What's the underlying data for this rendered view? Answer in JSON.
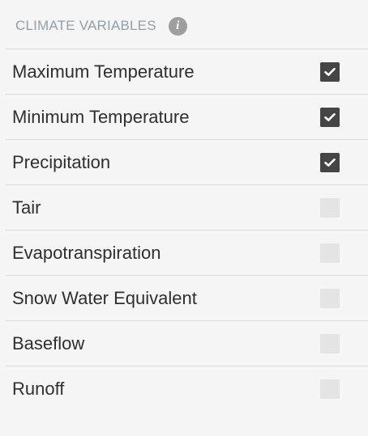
{
  "section": {
    "title": "CLIMATE VARIABLES",
    "info_glyph": "i"
  },
  "colors": {
    "background": "#f5f5f5",
    "header_text": "#8fa1ad",
    "info_icon": "#9e9e9e",
    "checkbox_checked": "#454545",
    "checkbox_unchecked": "#e4e4e4",
    "divider": "#dedede"
  },
  "variables": [
    {
      "label": "Maximum Temperature",
      "checked": true
    },
    {
      "label": "Minimum Temperature",
      "checked": true
    },
    {
      "label": "Precipitation",
      "checked": true
    },
    {
      "label": "Tair",
      "checked": false
    },
    {
      "label": "Evapotranspiration",
      "checked": false
    },
    {
      "label": "Snow Water Equivalent",
      "checked": false
    },
    {
      "label": "Baseflow",
      "checked": false
    },
    {
      "label": "Runoff",
      "checked": false
    }
  ]
}
